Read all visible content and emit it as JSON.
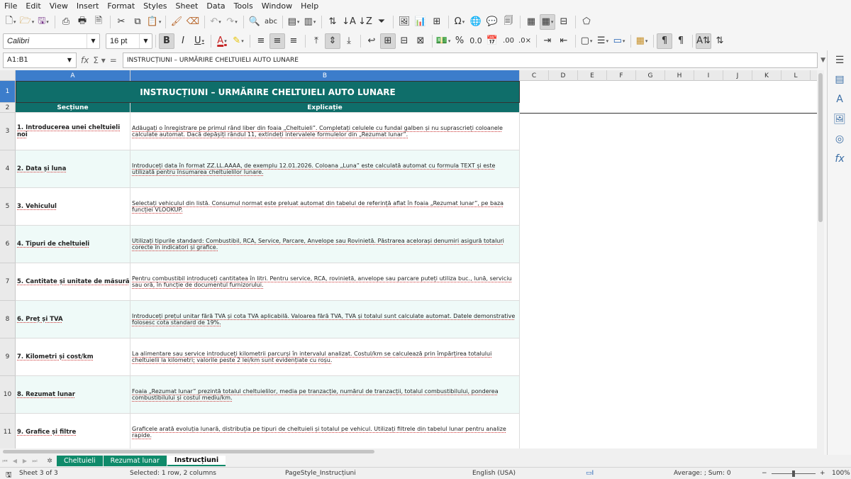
{
  "menubar": {
    "items": [
      "File",
      "Edit",
      "View",
      "Insert",
      "Format",
      "Styles",
      "Sheet",
      "Data",
      "Tools",
      "Window",
      "Help"
    ]
  },
  "format_bar": {
    "font_name": "Calibri",
    "font_size": "16 pt"
  },
  "formula_bar": {
    "name_box": "A1:B1",
    "content": "INSTRUCȚIUNI – URMĂRIRE CHELTUIELI AUTO LUNARE"
  },
  "columns": [
    "A",
    "B",
    "C",
    "D",
    "E",
    "F",
    "G",
    "H",
    "I",
    "J",
    "K",
    "L"
  ],
  "sheet": {
    "title": "INSTRUCȚIUNI – URMĂRIRE CHELTUIELI AUTO LUNARE",
    "headers": {
      "section": "Secțiune",
      "explanation": "Explicație"
    },
    "rows": [
      {
        "row_num": "1"
      },
      {
        "row_num": "2"
      },
      {
        "row_num": "3",
        "section": "1. Introducerea unei cheltuieli noi",
        "explanation": "Adăugați o înregistrare pe primul rând liber din foaia „Cheltuieli”. Completați celulele cu fundal galben și nu suprascrieți coloanele calculate automat. Dacă depășiți rândul 11, extindeți intervalele formulelor din „Rezumat lunar”."
      },
      {
        "row_num": "4",
        "section": "2. Data și luna",
        "explanation": "Introduceți data în format ZZ.LL.AAAA, de exemplu 12.01.2026. Coloana „Luna” este calculată automat cu formula TEXT și este utilizată pentru însumarea cheltuielilor lunare."
      },
      {
        "row_num": "5",
        "section": "3. Vehiculul",
        "explanation": "Selectați vehiculul din listă. Consumul normat este preluat automat din tabelul de referință aflat în foaia „Rezumat lunar”, pe baza funcției VLOOKUP."
      },
      {
        "row_num": "6",
        "section": "4. Tipuri de cheltuieli",
        "explanation": "Utilizați tipurile standard: Combustibil, RCA, Service, Parcare, Anvelope sau Rovinietă. Păstrarea acelorași denumiri asigură totaluri corecte în indicatori și grafice."
      },
      {
        "row_num": "7",
        "section": "5. Cantitate și unitate de măsură",
        "explanation": "Pentru combustibil introduceți cantitatea în litri. Pentru service, RCA, rovinietă, anvelope sau parcare puteți utiliza buc., lună, serviciu sau oră, în funcție de documentul furnizorului."
      },
      {
        "row_num": "8",
        "section": "6. Preț și TVA",
        "explanation": "Introduceți prețul unitar fără TVA și cota TVA aplicabilă. Valoarea fără TVA, TVA și totalul sunt calculate automat. Datele demonstrative folosesc cota standard de 19%."
      },
      {
        "row_num": "9",
        "section": "7. Kilometri și cost/km",
        "explanation": "La alimentare sau service introduceți kilometrii parcurși în intervalul analizat. Costul/km se calculează prin împărțirea totalului cheltuielii la kilometri; valorile peste 2 lei/km sunt evidențiate cu roșu."
      },
      {
        "row_num": "10",
        "section": "8. Rezumat lunar",
        "explanation": "Foaia „Rezumat lunar” prezintă totalul cheltuielilor, media pe tranzacție, numărul de tranzacții, totalul combustibilului, ponderea combustibilului și costul mediu/km."
      },
      {
        "row_num": "11",
        "section": "9. Grafice și filtre",
        "explanation": "Graficele arată evoluția lunară, distribuția pe tipuri de cheltuieli și totalul pe vehicul. Utilizați filtrele din tabelul lunar pentru analize rapide."
      }
    ]
  },
  "sheet_tabs": [
    "Cheltuieli",
    "Rezumat lunar",
    "Instrucțiuni"
  ],
  "active_tab": "Instrucțiuni",
  "status_bar": {
    "sheet_info": "Sheet 3 of 3",
    "selection": "Selected: 1 row, 2 columns",
    "page_style": "PageStyle_Instrucțiuni",
    "language": "English (USA)",
    "summary": "Average: ; Sum: 0",
    "zoom": "100%"
  },
  "colors": {
    "header_teal": "#0f6e6a",
    "row_tint": "#effaf8",
    "selection_blue": "#3c7dcb",
    "tab_teal": "#0f8a6a"
  }
}
